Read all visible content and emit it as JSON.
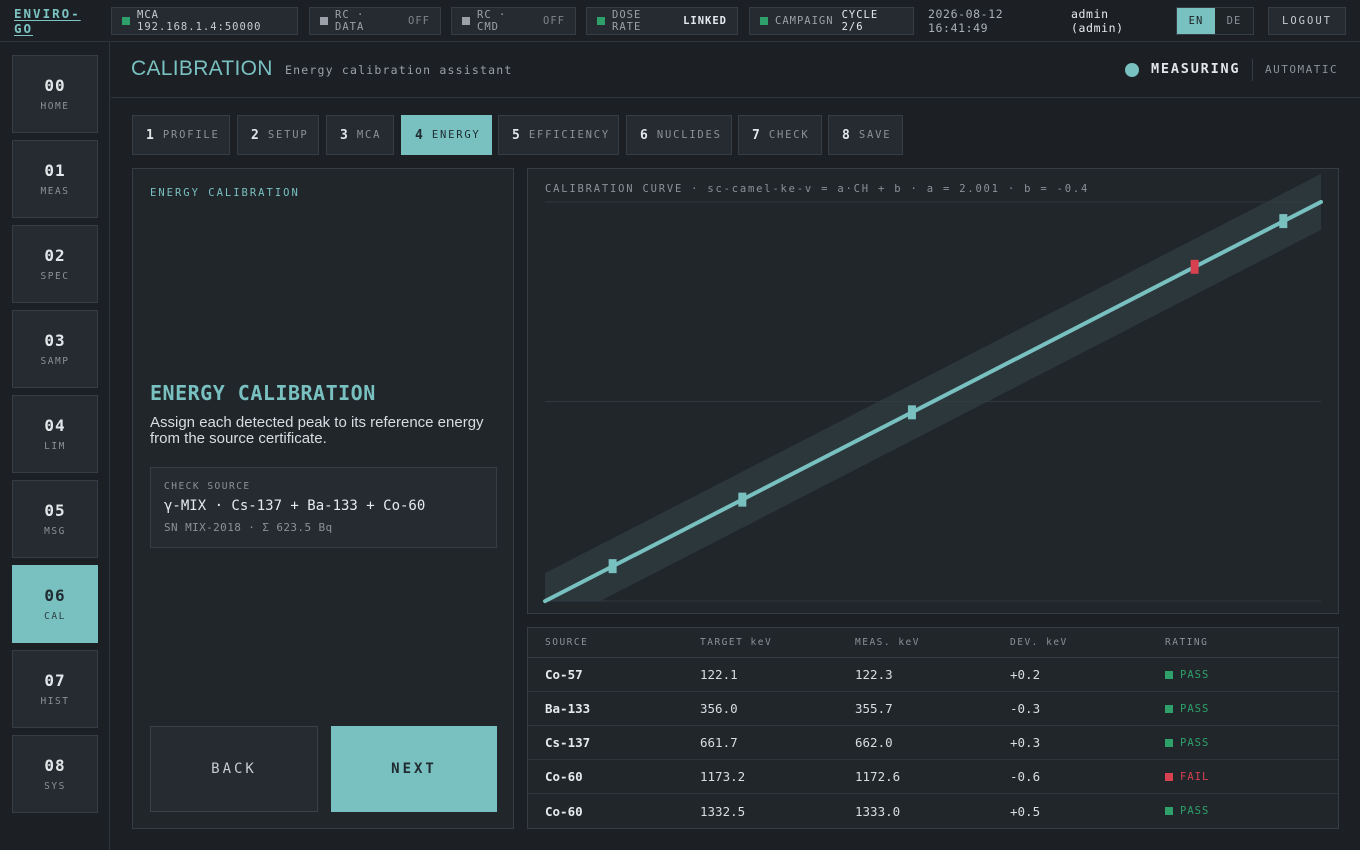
{
  "app": {
    "logo": "ENVIRO-GO"
  },
  "topbar": {
    "mca": {
      "label": "MCA 192.168.1.4:50000",
      "color": "#2ea06a"
    },
    "rc_data": {
      "label": "RC · DATA",
      "value": "OFF",
      "color": "#9aa1a8"
    },
    "rc_cmd": {
      "label": "RC · CMD",
      "value": "OFF",
      "color": "#9aa1a8"
    },
    "dose_rate": {
      "label": "DOSE RATE",
      "value": "LINKED",
      "color": "#2ea06a"
    },
    "campaign": {
      "label": "CAMPAIGN",
      "value": "CYCLE 2/6",
      "color": "#2ea06a"
    },
    "date": "2026-08-12",
    "time": "16:41:49",
    "user": "admin",
    "role": "(admin)",
    "lang_active": "EN",
    "lang_inactive": "DE",
    "logout": "LOGOUT"
  },
  "sidenav": {
    "items": [
      {
        "num": "00",
        "label": "HOME"
      },
      {
        "num": "01",
        "label": "MEAS"
      },
      {
        "num": "02",
        "label": "SPEC"
      },
      {
        "num": "03",
        "label": "SAMP"
      },
      {
        "num": "04",
        "label": "LIM"
      },
      {
        "num": "05",
        "label": "MSG"
      },
      {
        "num": "06",
        "label": "CAL"
      },
      {
        "num": "07",
        "label": "HIST"
      },
      {
        "num": "08",
        "label": "SYS"
      }
    ],
    "active_index": 6
  },
  "header": {
    "title": "CALIBRATION",
    "subtitle": "Energy calibration assistant",
    "status": "MEASURING",
    "mode": "AUTOMATIC"
  },
  "stepper": {
    "steps": [
      {
        "num": "1",
        "label": "PROFILE"
      },
      {
        "num": "2",
        "label": "SETUP"
      },
      {
        "num": "3",
        "label": "MCA"
      },
      {
        "num": "4",
        "label": "ENERGY"
      },
      {
        "num": "5",
        "label": "EFFICIENCY"
      },
      {
        "num": "6",
        "label": "NUCLIDES"
      },
      {
        "num": "7",
        "label": "CHECK"
      },
      {
        "num": "8",
        "label": "SAVE"
      }
    ],
    "active_index": 3
  },
  "left": {
    "section_label": "ENERGY CALIBRATION",
    "title": "ENERGY CALIBRATION",
    "description": "Assign each detected peak to its reference energy from the source certificate.",
    "source": {
      "label": "CHECK SOURCE",
      "value": "γ-MIX · Cs-137 + Ba-133 + Co-60",
      "sub": "SN MIX-2018 · Σ 623.5 Bq"
    },
    "back": "BACK",
    "next": "NEXT"
  },
  "chart": {
    "title": "CALIBRATION CURVE · sc-camel-ke-v = a·CH + b · a = 2.001 · b = -0.4"
  },
  "chart_data": {
    "type": "line",
    "title": "CALIBRATION CURVE · sc-camel-ke-v = a·CH + b · a = 2.001 · b = -0.4",
    "series": [
      {
        "name": "",
        "values": [
          122.3,
          355.7,
          662.0,
          1172.6,
          1333.0
        ]
      }
    ],
    "x": [
      61,
      178,
      331,
      586,
      666
    ],
    "fit": {
      "a": 2.001,
      "b": -0.4
    },
    "point_status": [
      "pass",
      "pass",
      "pass",
      "fail",
      "pass"
    ],
    "grid": true,
    "colors": {
      "line": "#79c0c0",
      "band": "#2f3d42",
      "pass": "#79c0c0",
      "fail": "#d6404f"
    }
  },
  "table": {
    "headers": [
      "SOURCE",
      "TARGET keV",
      "MEAS. keV",
      "DEV. keV",
      "RATING"
    ],
    "rows": [
      {
        "source": "Co-57",
        "target": "122.1",
        "meas": "122.3",
        "dev": "+0.2",
        "rating": "PASS",
        "color": "#2ea06a"
      },
      {
        "source": "Ba-133",
        "target": "356.0",
        "meas": "355.7",
        "dev": "-0.3",
        "rating": "PASS",
        "color": "#2ea06a"
      },
      {
        "source": "Cs-137",
        "target": "661.7",
        "meas": "662.0",
        "dev": "+0.3",
        "rating": "PASS",
        "color": "#2ea06a"
      },
      {
        "source": "Co-60",
        "target": "1173.2",
        "meas": "1172.6",
        "dev": "-0.6",
        "rating": "FAIL",
        "color": "#d6404f"
      },
      {
        "source": "Co-60",
        "target": "1332.5",
        "meas": "1333.0",
        "dev": "+0.5",
        "rating": "PASS",
        "color": "#2ea06a"
      }
    ]
  },
  "colors": {
    "accent": "#79c0c0",
    "pass": "#2ea06a",
    "fail": "#d6404f"
  }
}
